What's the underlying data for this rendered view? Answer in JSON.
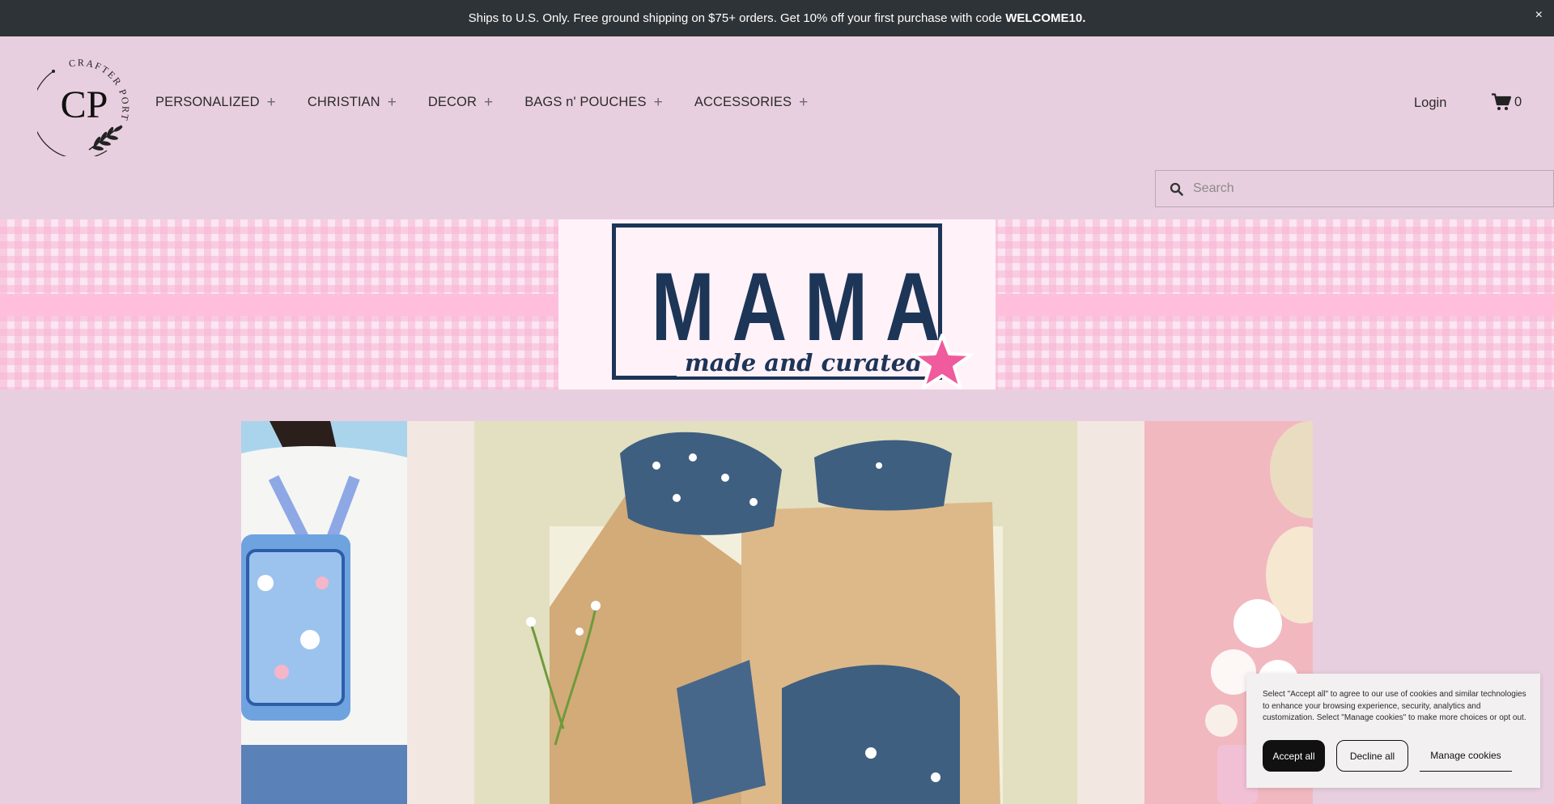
{
  "announcement": {
    "text": "Ships to U.S. Only. Free ground shipping on $75+ orders. Get 10% off your first purchase with code ",
    "code": "WELCOME10.",
    "close_symbol": "×"
  },
  "logo": {
    "monogram": "CP",
    "wordmark": "CRAFTER PORT"
  },
  "nav": {
    "items": [
      {
        "label": "PERSONALIZED"
      },
      {
        "label": "CHRISTIAN"
      },
      {
        "label": "DECOR"
      },
      {
        "label": "BAGS n' POUCHES"
      },
      {
        "label": "ACCESSORIES"
      }
    ],
    "expand_symbol": "+"
  },
  "header": {
    "login_label": "Login",
    "cart_count": "0"
  },
  "search": {
    "placeholder": "Search",
    "value": ""
  },
  "hero": {
    "title": "MAMA",
    "subtitle": "made and curated"
  },
  "cookie": {
    "message": "Select \"Accept all\" to agree to our use of cookies and similar technologies to enhance your browsing experience, security, analytics and customization. Select \"Manage cookies\" to make more choices or opt out.",
    "accept_label": "Accept all",
    "decline_label": "Decline all",
    "manage_label": "Manage cookies"
  },
  "colors": {
    "announcement_bg": "#2e3337",
    "page_bg": "#e8cfdf",
    "hero_navy": "#1d3557",
    "hero_pink": "#ffbedc",
    "star_pink": "#ef5b9c"
  },
  "icons": {
    "search": "search-icon",
    "cart": "cart-icon",
    "close": "close-icon",
    "star": "star-icon"
  }
}
